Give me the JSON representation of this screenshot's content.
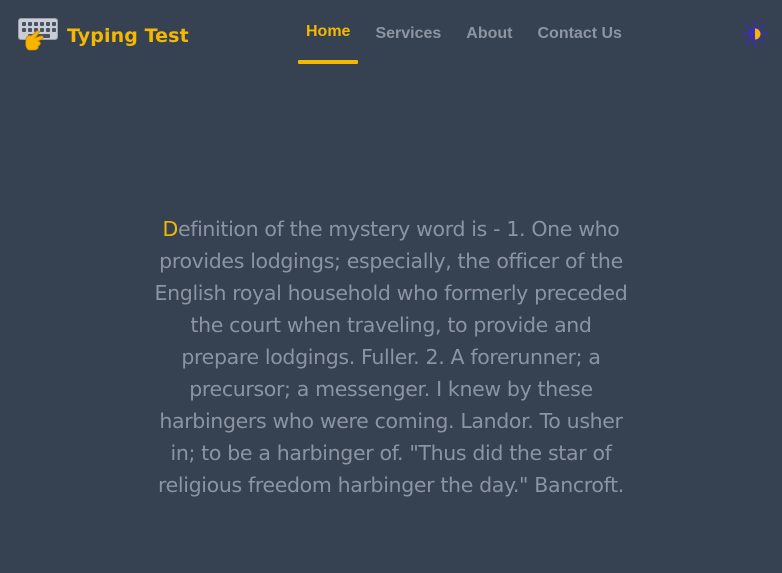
{
  "brand": {
    "title": "Typing Test",
    "icon": "keyboard-hand-icon"
  },
  "nav": {
    "items": [
      {
        "label": "Home",
        "active": true
      },
      {
        "label": "Services",
        "active": false
      },
      {
        "label": "About",
        "active": false
      },
      {
        "label": "Contact Us",
        "active": false
      }
    ]
  },
  "theme_toggle": {
    "icon": "theme-toggle-icon"
  },
  "typing": {
    "current_char": "D",
    "remaining_text": "efinition of the mystery word is - 1. One who provides lodgings; especially, the officer of the English royal household who formerly preceded the court when traveling, to provide and prepare lodgings. Fuller. 2. A forerunner; a precursor; a messenger. I knew by these harbingers who were coming. Landor. To usher in; to be a harbinger of. \"Thus did the star of religious freedom harbinger the day.\" Bancroft."
  },
  "colors": {
    "background": "#364152",
    "accent": "#f5b800",
    "text_muted": "#8c94a1"
  }
}
